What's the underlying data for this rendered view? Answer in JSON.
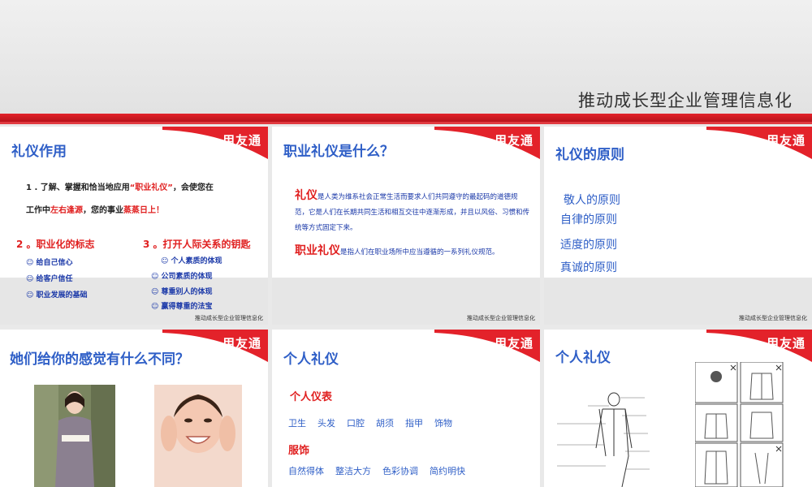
{
  "banner": {
    "title": "推动成长型企业管理信息化"
  },
  "brand": {
    "logo": "用友通",
    "footer": "推动成长型企业管理信息化"
  },
  "colors": {
    "accent_red": "#e02020",
    "title_blue": "#2f5fc7",
    "body_blue": "#1a38a8"
  },
  "slide1": {
    "title": "礼仪作用",
    "p1_a": "1 . 了解、掌握和恰当地应用",
    "p1_hl": "“职业礼仪”",
    "p1_b": "，会使您在",
    "p2_a": "工作中",
    "p2_hl1": "左右逢源",
    "p2_b": "，您的事业",
    "p2_hl2": "蒸蒸日上！",
    "h2": "2 。职业化的标志",
    "list2": [
      "☺ 给自己信心",
      "☺ 给客户信任",
      "☺ 职业发展的基础"
    ],
    "h3": "3 。打开人际关系的钥匙",
    "list3": [
      "☺ 个人素质的体现",
      "☺ 公司素质的体现",
      "☺ 尊重别人的体现",
      "☺ 赢得尊重的法宝"
    ]
  },
  "slide2": {
    "title": "职业礼仪是什么？",
    "term1": "礼仪",
    "def1": "是人类为维系社会正常生活而要求人们共同遵守的最起码的道德规范，它是人们在长期共同生活和相互交往中逐渐形成，并且以风俗、习惯和传统等方式固定下来。",
    "term2": "职业礼仪",
    "def2": "是指人们在职业场所中应当遵循的一系列礼仪规范。"
  },
  "slide3": {
    "title": "礼仪的原则",
    "items": [
      "敬人的原则",
      "自律的原则",
      "适度的原则",
      "真诚的原则"
    ]
  },
  "slide4": {
    "title": "她们给你的感觉有什么不同？"
  },
  "slide5": {
    "title": "个人礼仪",
    "h1": "个人仪表",
    "row1": [
      "卫生",
      "头发",
      "口腔",
      "胡须",
      "指甲",
      "饰物"
    ],
    "h2": "服饰",
    "row2": [
      "自然得体",
      "整洁大方",
      "色彩协调",
      "简约明快"
    ]
  },
  "slide6": {
    "title": "个人礼仪"
  }
}
